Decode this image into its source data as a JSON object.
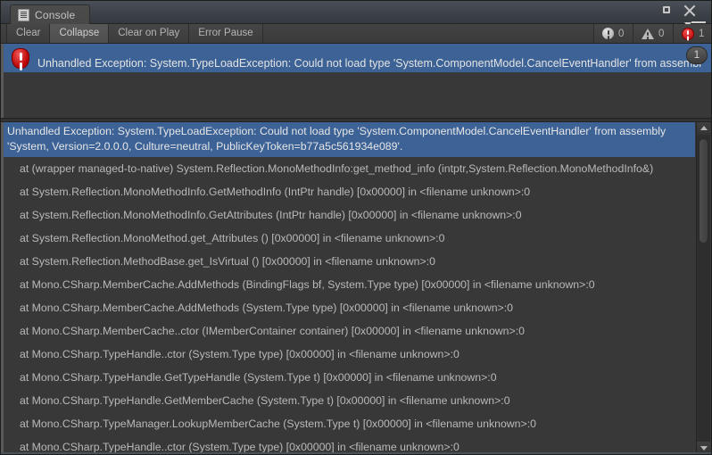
{
  "window": {
    "tab_label": "Console",
    "tab_icon": "console-document-icon",
    "maximize_icon": "maximize-icon",
    "close_icon": "close-icon",
    "menu_icon": "window-menu-icon",
    "colors": {
      "background": "#383838",
      "selection_blue": "#3C6296",
      "error_red": "#BA0000",
      "titlebar": "#434A52",
      "text": "#B9B9B9"
    }
  },
  "toolbar": {
    "buttons": [
      {
        "label": "Clear",
        "active": false
      },
      {
        "label": "Collapse",
        "active": true
      },
      {
        "label": "Clear on Play",
        "active": false
      },
      {
        "label": "Error Pause",
        "active": false
      }
    ],
    "counters": [
      {
        "icon": "info-icon",
        "count": "0"
      },
      {
        "icon": "warning-icon",
        "count": "0"
      },
      {
        "icon": "error-icon",
        "count": "1"
      }
    ]
  },
  "log_list": {
    "selected_row": {
      "icon": "error-icon",
      "text": "Unhandled Exception: System.TypeLoadException: Could not load type 'System.ComponentModel.CancelEventHandler' from assembl",
      "collapse_count": "1"
    }
  },
  "detail": {
    "header_lines": [
      "Unhandled Exception: System.TypeLoadException: Could not load type 'System.ComponentModel.CancelEventHandler' from assembly",
      "'System, Version=2.0.0.0, Culture=neutral, PublicKeyToken=b77a5c561934e089'."
    ],
    "stack_trace": [
      "at (wrapper managed-to-native) System.Reflection.MonoMethodInfo:get_method_info (intptr,System.Reflection.MonoMethodInfo&)",
      "at System.Reflection.MonoMethodInfo.GetMethodInfo (IntPtr handle) [0x00000] in <filename unknown>:0",
      "at System.Reflection.MonoMethodInfo.GetAttributes (IntPtr handle) [0x00000] in <filename unknown>:0",
      "at System.Reflection.MonoMethod.get_Attributes () [0x00000] in <filename unknown>:0",
      "at System.Reflection.MethodBase.get_IsVirtual () [0x00000] in <filename unknown>:0",
      "at Mono.CSharp.MemberCache.AddMethods (BindingFlags bf, System.Type type) [0x00000] in <filename unknown>:0",
      "at Mono.CSharp.MemberCache.AddMethods (System.Type type) [0x00000] in <filename unknown>:0",
      "at Mono.CSharp.MemberCache..ctor (IMemberContainer container) [0x00000] in <filename unknown>:0",
      "at Mono.CSharp.TypeHandle..ctor (System.Type type) [0x00000] in <filename unknown>:0",
      "at Mono.CSharp.TypeHandle.GetTypeHandle (System.Type t) [0x00000] in <filename unknown>:0",
      "at Mono.CSharp.TypeHandle.GetMemberCache (System.Type t) [0x00000] in <filename unknown>:0",
      "at Mono.CSharp.TypeManager.LookupMemberCache (System.Type t) [0x00000] in <filename unknown>:0",
      "at Mono.CSharp.TypeHandle..ctor (System.Type type) [0x00000] in <filename unknown>:0"
    ]
  },
  "scrollbar": {
    "up_arrow_icon": "scroll-up-arrow-icon",
    "down_arrow_icon": "scroll-down-arrow-icon"
  }
}
